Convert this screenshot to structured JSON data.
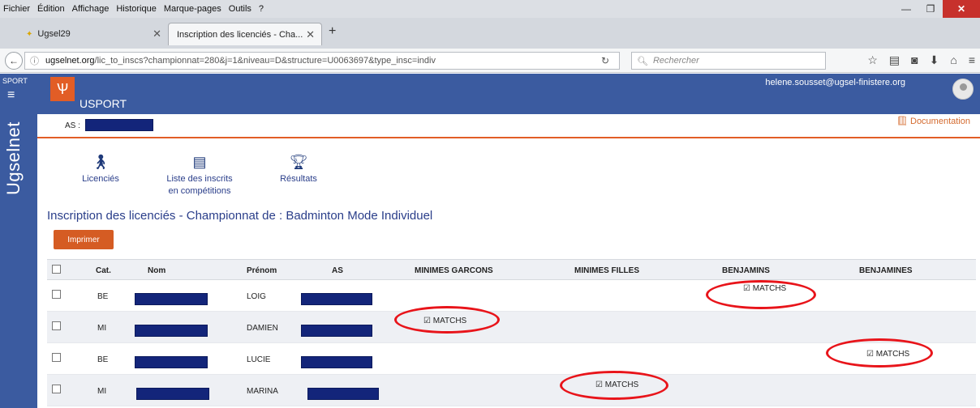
{
  "menubar": {
    "items": [
      "Fichier",
      "Édition",
      "Affichage",
      "Historique",
      "Marque-pages",
      "Outils",
      "?"
    ]
  },
  "tabs": [
    {
      "label": "Ugsel29"
    },
    {
      "label": "Inscription des licenciés - Cha..."
    }
  ],
  "navbar": {
    "url_host": "ugselnet.org",
    "url_path": "/lic_to_inscs?championnat=280&j=1&niveau=D&structure=U0063697&type_insc=indiv",
    "search_placeholder": "Rechercher"
  },
  "rail": {
    "sport": "SPORT",
    "vertical_title": "Ugselnet"
  },
  "header": {
    "brand": "USPORT",
    "email": "helene.sousset@ugsel-finistere.org"
  },
  "asbar": {
    "label": "AS :",
    "documentation": "Documentation"
  },
  "quick": [
    {
      "label": "Licenciés"
    },
    {
      "label1": "Liste des inscrits",
      "label2": "en compétitions"
    },
    {
      "label": "Résultats"
    }
  ],
  "page": {
    "title": "Inscription des licenciés - Championnat de : Badminton Mode Individuel",
    "print_label": "Imprimer"
  },
  "table": {
    "headers": [
      "Cat.",
      "Nom",
      "Prénom",
      "AS",
      "MINIMES GARCONS",
      "MINIMES FILLES",
      "BENJAMINS",
      "BENJAMINES"
    ],
    "match_label": "☑ MATCHS",
    "rows": [
      {
        "cat": "BE",
        "prenom": "LOIG",
        "match_col": "BENJAMINS"
      },
      {
        "cat": "MI",
        "prenom": "DAMIEN",
        "match_col": "MINIMES GARCONS"
      },
      {
        "cat": "BE",
        "prenom": "LUCIE",
        "match_col": "BENJAMINES"
      },
      {
        "cat": "MI",
        "prenom": "MARINA",
        "match_col": "MINIMES FILLES"
      }
    ]
  },
  "colors": {
    "brand_blue": "#3b5ba0",
    "accent_orange": "#e25d26",
    "highlight_red": "#e8141a",
    "redaction": "#13257a"
  }
}
